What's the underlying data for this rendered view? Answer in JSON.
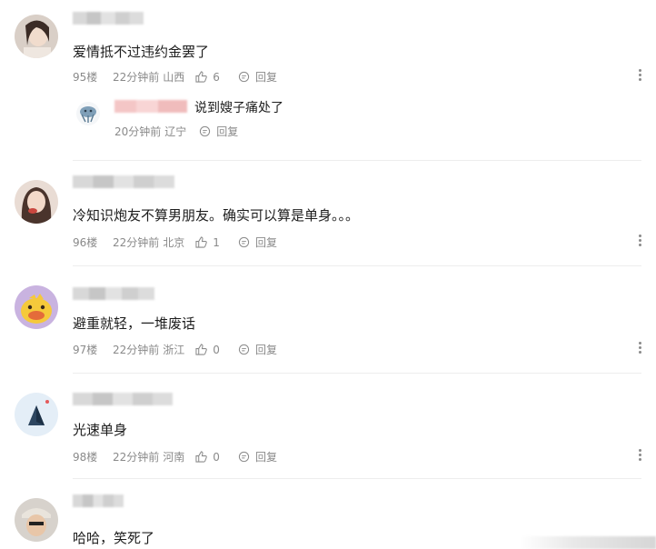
{
  "comments": [
    {
      "text": "爱情抵不过违约金罢了",
      "floor": "95楼",
      "time": "22分钟前",
      "location": "山西",
      "likes": "6",
      "reply_label": "回复",
      "replies": [
        {
          "text": "说到嫂子痛处了",
          "time": "20分钟前",
          "location": "辽宁",
          "reply_label": "回复"
        }
      ]
    },
    {
      "text": "冷知识炮友不算男朋友。确实可以算是单身。。。",
      "floor": "96楼",
      "time": "22分钟前",
      "location": "北京",
      "likes": "1",
      "reply_label": "回复"
    },
    {
      "text": "避重就轻，一堆废话",
      "floor": "97楼",
      "time": "22分钟前",
      "location": "浙江",
      "likes": "0",
      "reply_label": "回复"
    },
    {
      "text": "光速单身",
      "floor": "98楼",
      "time": "22分钟前",
      "location": "河南",
      "likes": "0",
      "reply_label": "回复"
    },
    {
      "text": "哈哈，笑死了"
    }
  ],
  "icons": {
    "like": "thumbs-up-icon",
    "reply": "reply-bubble-icon",
    "more": "more-vertical-icon"
  }
}
